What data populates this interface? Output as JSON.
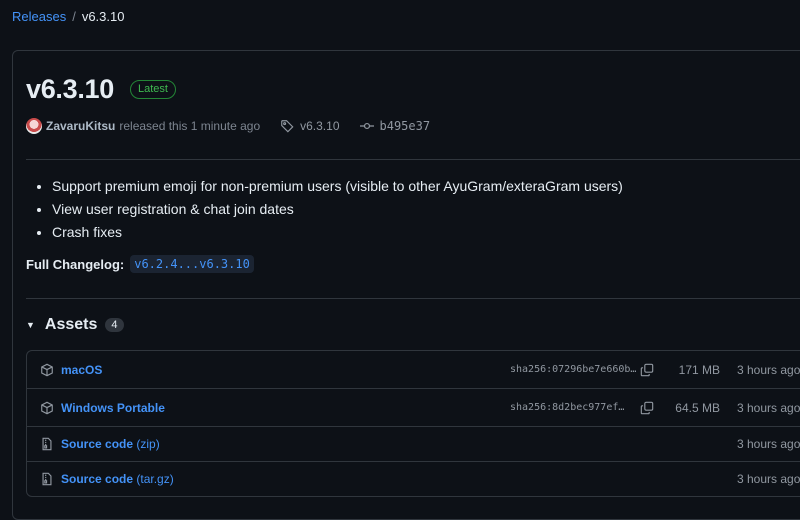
{
  "breadcrumb": {
    "parent": "Releases",
    "separator": "/",
    "current": "v6.3.10"
  },
  "release": {
    "title": "v6.3.10",
    "badge": "Latest",
    "author": "ZavaruKitsu",
    "released_text": "released this 1 minute ago",
    "tag": "v6.3.10",
    "commit": "b495e37"
  },
  "notes": {
    "items": [
      "Support premium emoji for non-premium users (visible to other AyuGram/exteraGram users)",
      "View user registration & chat join dates",
      "Crash fixes"
    ],
    "changelog_label": "Full Changelog:",
    "changelog_link": "v6.2.4...v6.3.10"
  },
  "assets": {
    "title": "Assets",
    "count": "4",
    "rows": [
      {
        "name": "macOS",
        "ext": "",
        "sha": "sha256:07296be7e660b…",
        "size": "171 MB",
        "time": "3 hours ago"
      },
      {
        "name": "Windows Portable",
        "ext": "",
        "sha": "sha256:8d2bec977ef…",
        "size": "64.5 MB",
        "time": "3 hours ago"
      },
      {
        "name": "Source code",
        "ext": "(zip)",
        "sha": "",
        "size": "",
        "time": "3 hours ago"
      },
      {
        "name": "Source code",
        "ext": "(tar.gz)",
        "sha": "",
        "size": "",
        "time": "3 hours ago"
      }
    ]
  },
  "icons": {
    "tag": "tag-icon",
    "commit": "git-commit-icon",
    "package": "package-icon",
    "zip": "file-zip-icon",
    "copy": "copy-icon",
    "caret": "triangle-down-icon"
  },
  "colors": {
    "background": "#0d1117",
    "link": "#4493f8",
    "latest": "#3fb950",
    "border": "#30363d"
  }
}
